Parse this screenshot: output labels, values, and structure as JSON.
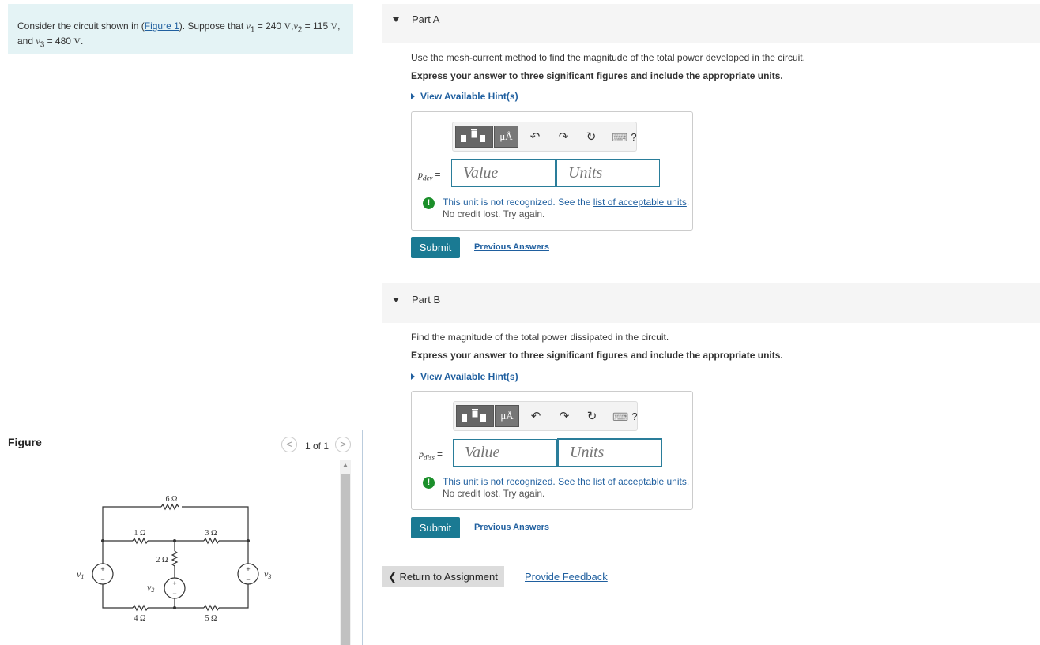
{
  "problem": {
    "intro": "Consider the circuit shown in (",
    "figure_link": "Figure 1",
    "after_link": "). Suppose that ",
    "v1": "v",
    "v1_sub": "1",
    "eq1": " = 240 ",
    "unit_v1": "V",
    "sep1": ",",
    "v2": "v",
    "v2_sub": "2",
    "eq2": " = 115 ",
    "unit_v2": "V",
    "sep2": ",",
    "line2_and": "and ",
    "v3": "v",
    "v3_sub": "3",
    "eq3": " = 480 ",
    "unit_v3": "V",
    "end": "."
  },
  "figure": {
    "label": "Figure",
    "pager_text": "1 of 1",
    "prev_glyph": "<",
    "next_glyph": ">",
    "circuit": {
      "r_top": "6 Ω",
      "r_left": "1 Ω",
      "r_mid_right": "3 Ω",
      "r_mid": "2 Ω",
      "r_bottom_left": "4 Ω",
      "r_bottom_right": "5 Ω",
      "v1_label": "v",
      "v1_sub": "1",
      "v2_label": "v",
      "v2_sub": "2",
      "v3_label": "v",
      "v3_sub": "3",
      "plus": "+",
      "minus": "−"
    }
  },
  "partA": {
    "title": "Part A",
    "question": "Use the mesh-current method to find the magnitude of the total power developed in the circuit.",
    "instruction": "Express your answer to three significant figures and include the appropriate units.",
    "hint": "View Available Hint(s)",
    "var": "p",
    "var_sub": "dev",
    "equals": "=",
    "value_placeholder": "Value",
    "units_placeholder": "Units",
    "error": "This unit is not recognized. See the ",
    "error_link": "list of acceptable units",
    "error_end": ".",
    "error_line2": "No credit lost. Try again.",
    "submit": "Submit",
    "previous": "Previous Answers"
  },
  "partB": {
    "title": "Part B",
    "question": "Find the magnitude of the total power dissipated in the circuit.",
    "instruction": "Express your answer to three significant figures and include the appropriate units.",
    "hint": "View Available Hint(s)",
    "var": "p",
    "var_sub": "diss",
    "equals": "=",
    "value_placeholder": "Value",
    "units_placeholder": "Units",
    "error": "This unit is not recognized. See the ",
    "error_link": "list of acceptable units",
    "error_end": ".",
    "error_line2": "No credit lost. Try again.",
    "submit": "Submit",
    "previous": "Previous Answers"
  },
  "toolbar": {
    "mu_label": "μÅ",
    "undo": "↶",
    "redo": "↷",
    "reset": "↻",
    "keyboard": "⌨",
    "help": "?",
    "error_icon": "!"
  },
  "footer": {
    "return_arrow": "❮",
    "return": " Return to Assignment",
    "feedback": "Provide Feedback"
  }
}
